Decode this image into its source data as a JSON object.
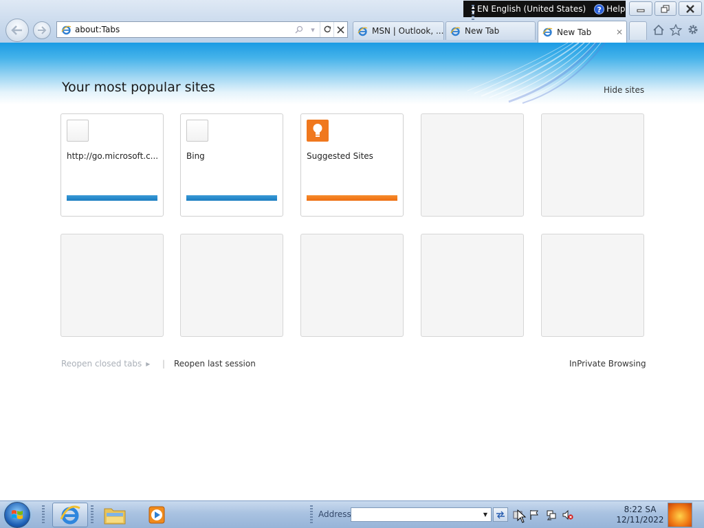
{
  "language_bar": {
    "lang": "EN English (United States)",
    "help": "Help"
  },
  "address_bar": {
    "url": "about:Tabs"
  },
  "tabs": [
    {
      "label": "MSN | Outlook, ..."
    },
    {
      "label": "New Tab"
    },
    {
      "label": "New Tab",
      "active": true
    }
  ],
  "new_tab_page": {
    "title": "Your most popular sites",
    "hide_sites": "Hide sites",
    "sites": [
      {
        "label": "http://go.microsoft.c...",
        "accent": "#1b7dc1"
      },
      {
        "label": "Bing",
        "accent": "#1b7dc1"
      },
      {
        "label": "Suggested Sites",
        "accent": "#ee6f12"
      }
    ],
    "reopen_closed_tabs": "Reopen closed tabs",
    "separator": "|",
    "reopen_last_session": "Reopen last session",
    "inprivate": "InPrivate Browsing"
  },
  "taskbar": {
    "address_label": "Address",
    "address_value": "",
    "clock_time": "8:22 SA",
    "clock_date": "12/11/2022"
  },
  "icons": [
    "back-arrow-icon",
    "forward-arrow-icon",
    "ie-icon",
    "search-icon",
    "dropdown-icon",
    "refresh-icon",
    "stop-icon",
    "home-icon",
    "favorites-star-icon",
    "tools-gear-icon",
    "lightbulb-icon",
    "windows-logo-icon",
    "folder-icon",
    "media-player-icon",
    "flag-icon",
    "network-icon",
    "volume-muted-icon",
    "go-arrows-icon"
  ]
}
